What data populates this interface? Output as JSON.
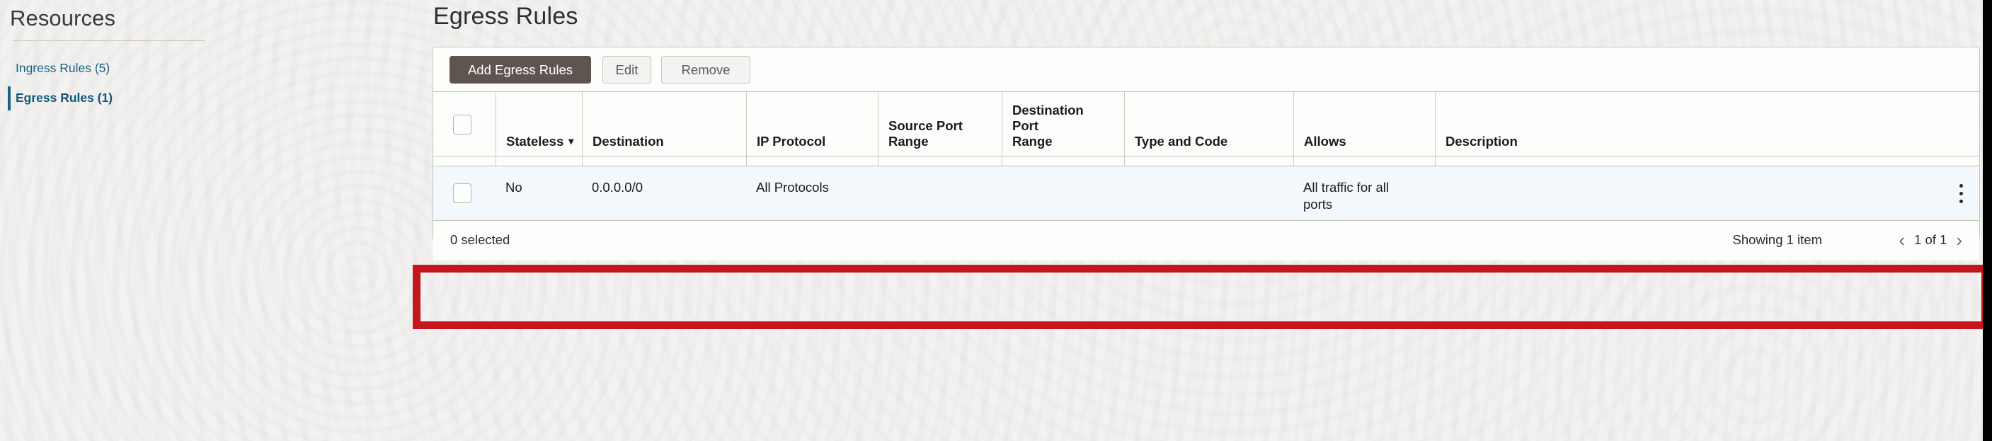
{
  "sidebar": {
    "title": "Resources",
    "items": [
      {
        "label": "Ingress Rules (5)",
        "active": false
      },
      {
        "label": "Egress Rules (1)",
        "active": true
      }
    ]
  },
  "main": {
    "title": "Egress Rules"
  },
  "toolbar": {
    "add_label": "Add Egress Rules",
    "edit_label": "Edit",
    "remove_label": "Remove"
  },
  "table": {
    "columns": [
      {
        "label": "",
        "key": "select"
      },
      {
        "label": "Stateless",
        "key": "stateless",
        "sortable": true,
        "sort_caret": "▾"
      },
      {
        "label": "Destination",
        "key": "destination"
      },
      {
        "label": "IP Protocol",
        "key": "ip_protocol"
      },
      {
        "label": "Source Port\nRange",
        "key": "source_port_range"
      },
      {
        "label": "Destination\nPort\nRange",
        "key": "destination_port_range"
      },
      {
        "label": "Type and Code",
        "key": "type_and_code"
      },
      {
        "label": "Allows",
        "key": "allows"
      },
      {
        "label": "Description",
        "key": "description"
      }
    ],
    "rows": [
      {
        "stateless": "No",
        "destination": "0.0.0.0/0",
        "ip_protocol": "All Protocols",
        "source_port_range": "",
        "destination_port_range": "",
        "type_and_code": "",
        "allows": "All traffic for all\nports",
        "description": ""
      }
    ]
  },
  "footer": {
    "selected_count": "0 selected",
    "showing": "Showing 1 item",
    "page_label": "1 of 1",
    "prev_icon": "‹",
    "next_icon": "›"
  },
  "icons": {
    "kebab": "kebab-menu-icon"
  },
  "colors": {
    "accent_link": "#1a6384",
    "primary_button": "#5e5551",
    "row_highlight": "#f2f8fc",
    "annotation": "#c4161c",
    "page_background": "#f3f2f0"
  }
}
